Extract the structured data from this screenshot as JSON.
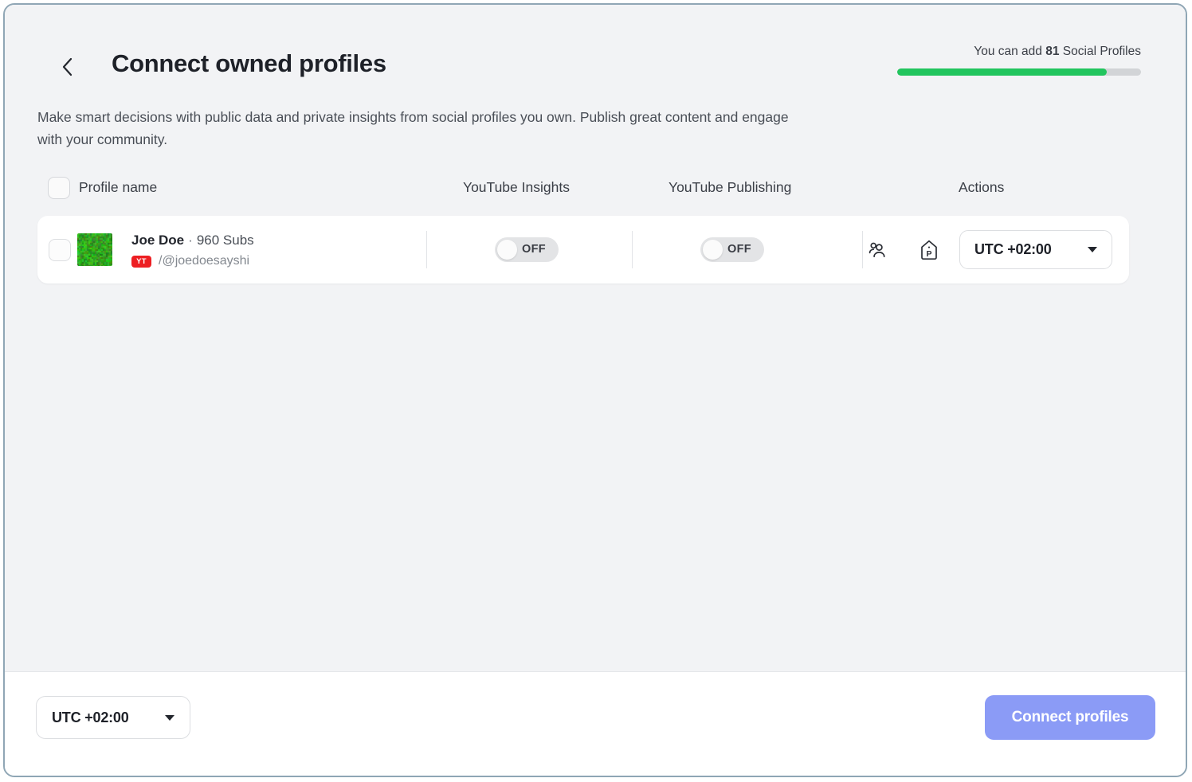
{
  "header": {
    "back_icon": "chevron-left-icon",
    "title": "Connect owned profiles",
    "quota_prefix": "You can add ",
    "quota_count": "81",
    "quota_suffix": " Social Profiles",
    "quota_percent": 86,
    "quota_fill_color": "#22c55e",
    "quota_track_color": "#d2d4d7"
  },
  "description": "Make smart decisions with public data and private insights from social profiles you own. Publish great content and engage with your community.",
  "table": {
    "columns": {
      "profile_name": "Profile name",
      "youtube_insights": "YouTube Insights",
      "youtube_publishing": "YouTube Publishing",
      "actions": "Actions"
    },
    "rows": [
      {
        "selected": false,
        "avatar": "green-grass-thumbnail",
        "name": "Joe Doe",
        "separator": "·",
        "subs": "960 Subs",
        "network_badge": "YT",
        "network_badge_color": "#ed1f23",
        "handle": "/@joedoesayshi",
        "insights_toggle": "OFF",
        "publishing_toggle": "OFF",
        "action_icons": [
          "people-icon",
          "tag-p-icon"
        ],
        "timezone": "UTC +02:00"
      }
    ]
  },
  "footer": {
    "timezone": "UTC +02:00",
    "connect_label": "Connect profiles",
    "connect_color": "#8b9bf6"
  }
}
